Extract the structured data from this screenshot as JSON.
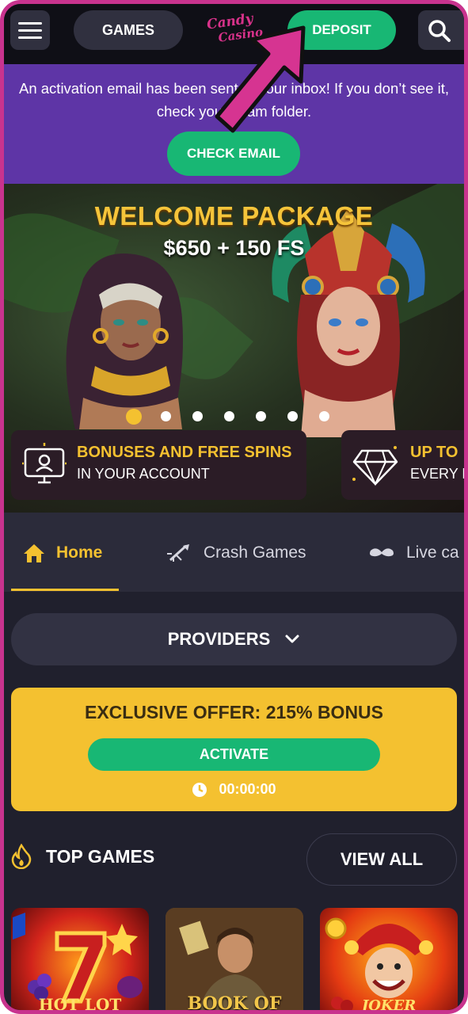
{
  "header": {
    "games_label": "GAMES",
    "logo_line1": "Candy",
    "logo_line2": "Casino",
    "deposit_label": "DEPOSIT"
  },
  "activation": {
    "line1": "An activation email has been sent to your inbox! If you don’t see it,",
    "line2": "check your spam folder.",
    "button_label": "CHECK EMAIL"
  },
  "hero": {
    "title": "WELCOME PACKAGE",
    "subtitle": "$650 + 150 FS",
    "slides_count": 7,
    "active_slide": 1
  },
  "promos": [
    {
      "title": "BONUSES AND FREE SPINS",
      "subtitle": "IN YOUR ACCOUNT",
      "icon": "monitor-user-icon"
    },
    {
      "title": "UP TO",
      "subtitle": "EVERY D",
      "icon": "diamond-icon"
    }
  ],
  "tabs": [
    {
      "label": "Home",
      "icon": "home-icon",
      "active": true
    },
    {
      "label": "Crash Games",
      "icon": "rocket-icon",
      "active": false
    },
    {
      "label": "Live ca",
      "icon": "mustache-icon",
      "active": false
    }
  ],
  "providers": {
    "label": "PROVIDERS"
  },
  "offer": {
    "title": "EXCLUSIVE OFFER: 215% BONUS",
    "button_label": "ACTIVATE",
    "timer": "00:00:00"
  },
  "top_games": {
    "title": "TOP GAMES",
    "view_all_label": "VIEW ALL",
    "games": [
      {
        "caption": "HOT LOT"
      },
      {
        "caption": "BOOK OF"
      },
      {
        "caption": "JOKER"
      }
    ]
  },
  "colors": {
    "brand_green": "#18b774",
    "accent_yellow": "#f4c130",
    "banner_purple": "#5e35a6",
    "frame_pink": "#c8338e"
  }
}
